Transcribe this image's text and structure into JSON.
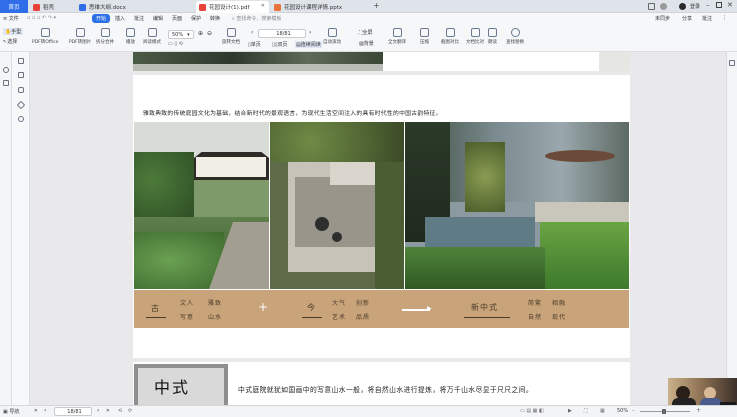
{
  "tabs": {
    "home": "首页",
    "items": [
      {
        "label": "稻壳",
        "color": "#e8433a"
      },
      {
        "label": "思维大纲.docx",
        "color": "#2f6ee8"
      },
      {
        "label": "花园设计(1).pdf",
        "color": "#e8433a"
      },
      {
        "label": "花园设计课程详情.pptx",
        "color": "#e8743a"
      }
    ],
    "add": "+",
    "right_label": "登录"
  },
  "menu": {
    "file": "文件",
    "items": [
      "开始",
      "插入",
      "批注",
      "编辑",
      "页面",
      "保护",
      "转换"
    ],
    "active": "开始",
    "search_placeholder": "查找命令、搜索模板",
    "right": [
      "未同步",
      "分享",
      "批注"
    ]
  },
  "ribbon": {
    "hand": "手型",
    "select": "选择",
    "buttons": [
      "PDF转Office",
      "PDF转图片",
      "拆分合并",
      "播放",
      "阅读模式",
      "旋转文档",
      "单页",
      "双页",
      "连续阅读",
      "自动滚动",
      "全屏",
      "背景",
      "全文翻译",
      "压缩",
      "截图对比",
      "文档比对",
      "朗读",
      "查找替换"
    ],
    "zoom": "50%",
    "page_field": "18/81",
    "auto_scroll": "自动滚动"
  },
  "document": {
    "caption": "雅致典致的传统庭园文化为基础，结合新时代的景观语言，为现代生活空间注入的具有时代性的中国古韵特征。",
    "band": {
      "left_key": "古",
      "left_words": [
        "文人",
        "雅致",
        "写意",
        "山水"
      ],
      "plus": "+",
      "mid_key": "今",
      "mid_words": [
        "大气",
        "创新",
        "艺术",
        "品质"
      ],
      "result": "新中式",
      "right_words": [
        "简繁",
        "相融",
        "自然",
        "现代"
      ]
    },
    "next_title": "中式",
    "next_text": "中式庭院就犹如国画中的写意山水一般，将自然山水进行提炼，将万千山水尽显于尺尺之间。"
  },
  "status": {
    "nav": "导航",
    "page": "18/81",
    "zoom": "50%"
  },
  "colors": {
    "accent": "#2d6fe6",
    "band": "#c9a47a"
  }
}
